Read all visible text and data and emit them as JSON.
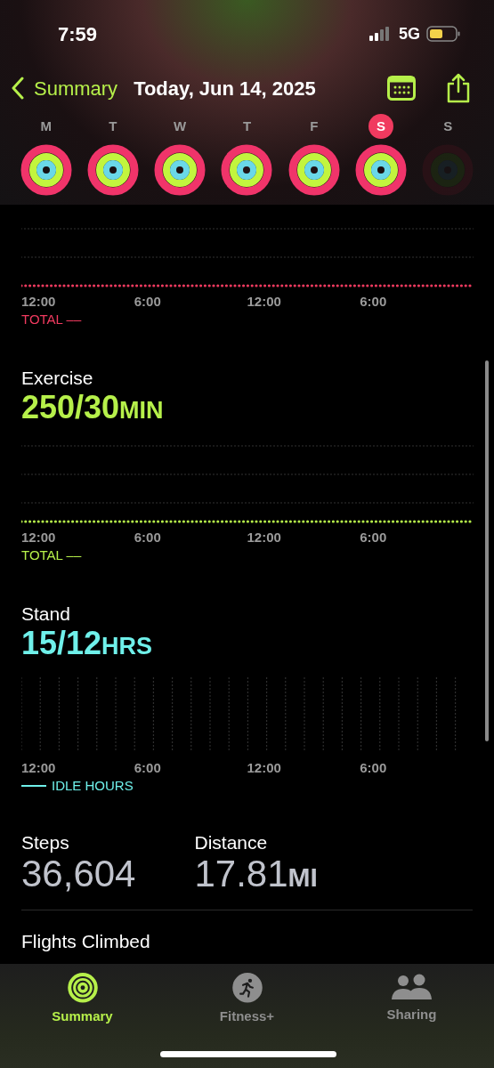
{
  "status_bar": {
    "time": "7:59",
    "network": "5G"
  },
  "nav": {
    "back": "Summary",
    "title": "Today, Jun 14, 2025"
  },
  "days": [
    {
      "letter": "M",
      "selected": false,
      "closed": true
    },
    {
      "letter": "T",
      "selected": false,
      "closed": true
    },
    {
      "letter": "W",
      "selected": false,
      "closed": true
    },
    {
      "letter": "T",
      "selected": false,
      "closed": true
    },
    {
      "letter": "F",
      "selected": false,
      "closed": true
    },
    {
      "letter": "S",
      "selected": true,
      "closed": true
    },
    {
      "letter": "S",
      "selected": false,
      "closed": false
    }
  ],
  "sections": [
    {
      "kind": "line",
      "color": "#f03a5f",
      "ticks": [
        "12:00",
        "6:00",
        "12:00",
        "6:00"
      ],
      "legend": "TOTAL ––"
    },
    {
      "kind": "line",
      "color": "#b6f04a",
      "title": "Exercise",
      "value": "250/30",
      "unit": "MIN",
      "ticks": [
        "12:00",
        "6:00",
        "12:00",
        "6:00"
      ],
      "legend": "TOTAL ––"
    },
    {
      "kind": "bars",
      "color": "#6ff0ea",
      "title": "Stand",
      "value": "15/12",
      "unit": "HRS",
      "ticks": [
        "12:00",
        "6:00",
        "12:00",
        "6:00"
      ],
      "legend": "IDLE HOURS"
    }
  ],
  "stats": [
    {
      "label": "Steps",
      "value": "36,604"
    },
    {
      "label": "Distance",
      "value": "17.81",
      "unit": "MI"
    }
  ],
  "cut_stat": {
    "label": "Flights Climbed"
  },
  "tab_bar": [
    {
      "label": "Summary",
      "selected": true,
      "kind": "rings"
    },
    {
      "label": "Fitness+",
      "selected": false,
      "kind": "runner"
    },
    {
      "label": "Sharing",
      "selected": false,
      "kind": "people"
    }
  ]
}
